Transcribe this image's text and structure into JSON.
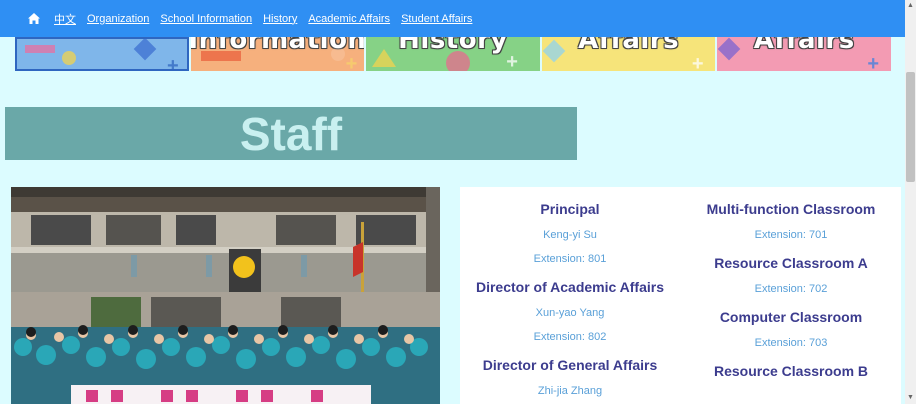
{
  "nav": {
    "home_icon": "home-icon",
    "links": [
      "中文",
      "Organization",
      "School Information",
      "History",
      "Academic Affairs",
      "Student Affairs"
    ]
  },
  "banners": [
    "",
    "Information",
    "History",
    "Affairs",
    "Affairs"
  ],
  "staff_heading": "Staff",
  "left_column": [
    {
      "role": "Principal",
      "name": "Keng-yi Su",
      "extension": "Extension: 801"
    },
    {
      "role": "Director of Academic Affairs",
      "name": "Xun-yao Yang",
      "extension": "Extension: 802"
    },
    {
      "role": "Director of General Affairs",
      "name": "Zhi-jia Zhang",
      "extension": ""
    }
  ],
  "right_column": [
    {
      "role": "Multi-function Classroom",
      "extension": "Extension: 701"
    },
    {
      "role": "Resource Classroom A",
      "extension": "Extension: 702"
    },
    {
      "role": "Computer Classroom",
      "extension": "Extension: 703"
    },
    {
      "role": "Resource Classroom B",
      "extension": ""
    }
  ],
  "colors": {
    "nav_bg": "#2f8ff3",
    "page_bg": "#dcfcff",
    "staff_bar": "#6aa8a8",
    "role_text": "#3c3c8e",
    "detail_text": "#5aa0d8"
  }
}
